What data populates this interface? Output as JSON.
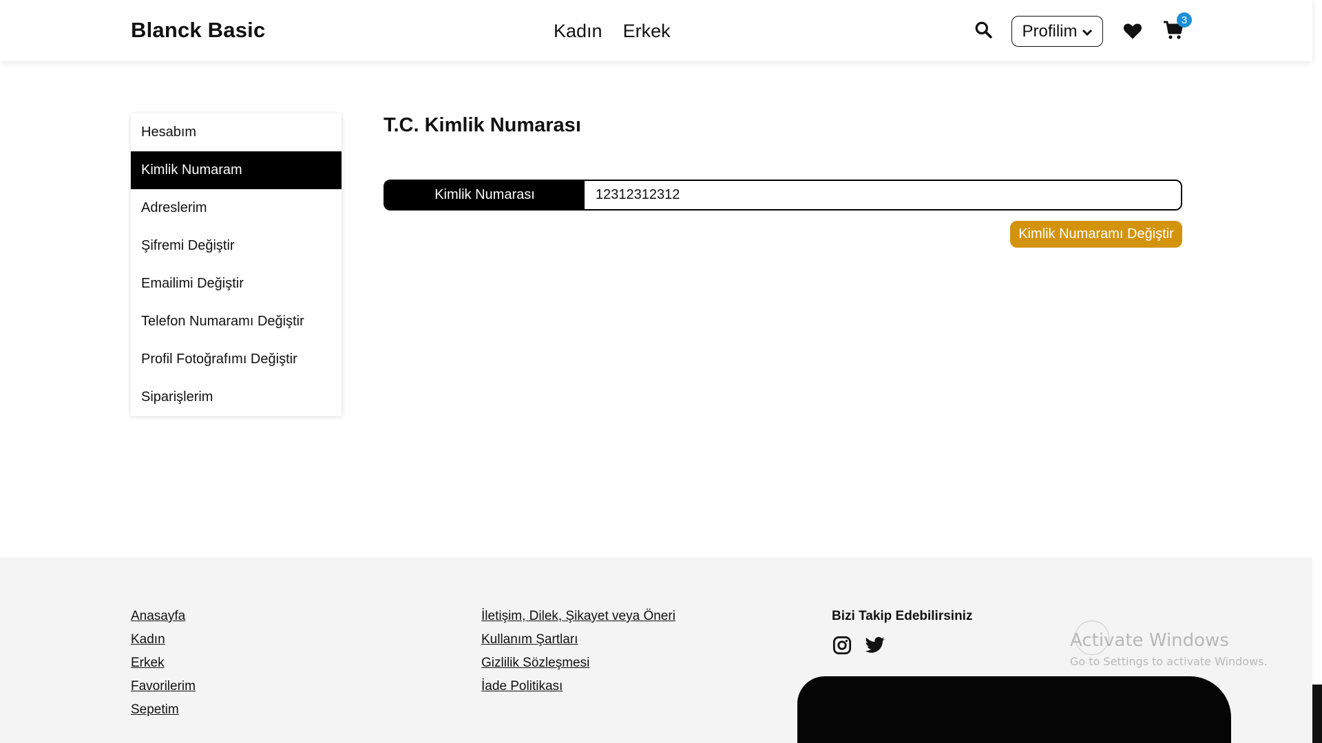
{
  "header": {
    "brand": "Blanck Basic",
    "nav": [
      "Kadın",
      "Erkek"
    ],
    "profile_label": "Profilim",
    "cart_count": "3",
    "icons": {
      "search": "search-icon",
      "favorites": "heart-icon",
      "cart": "cart-icon",
      "dropdown": "chevron-down-icon"
    }
  },
  "sidebar": {
    "items": [
      {
        "label": "Hesabım",
        "active": false
      },
      {
        "label": "Kimlik Numaram",
        "active": true
      },
      {
        "label": "Adreslerim",
        "active": false
      },
      {
        "label": "Şifremi Değiştir",
        "active": false
      },
      {
        "label": "Emailimi Değiştir",
        "active": false
      },
      {
        "label": "Telefon Numaramı Değiştir",
        "active": false
      },
      {
        "label": "Profil Fotoğrafımı Değiştir",
        "active": false
      },
      {
        "label": "Siparişlerim",
        "active": false
      }
    ]
  },
  "main": {
    "title": "T.C. Kimlik Numarası",
    "field_label": "Kimlik Numarası",
    "field_value": "12312312312",
    "button_label": "Kimlik Numaramı Değiştir"
  },
  "footer": {
    "col1": [
      "Anasayfa",
      "Kadın",
      "Erkek",
      "Favorilerim",
      "Sepetim"
    ],
    "col2": [
      "İletişim, Dilek, Şikayet veya Öneri",
      "Kullanım Şartları",
      "Gizlilik Sözleşmesi",
      "İade Politikası"
    ],
    "follow_title": "Bizi Takip Edebilirsiniz",
    "social_icons": [
      "instagram-icon",
      "twitter-icon"
    ]
  },
  "watermark": {
    "title": "Activate Windows",
    "subtitle": "Go to Settings to activate Windows."
  },
  "colors": {
    "accent_button": "#d4930d",
    "badge": "#1e8fd6",
    "active_sidebar": "#000000",
    "footer_bg": "#f4f4f4"
  }
}
